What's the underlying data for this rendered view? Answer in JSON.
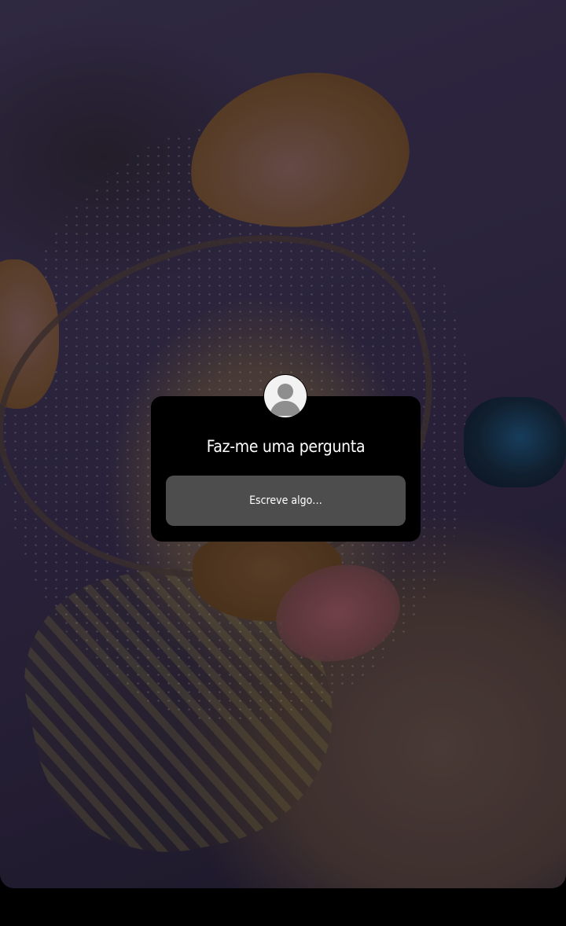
{
  "story": {
    "background_icon": "photo-background"
  },
  "question_sticker": {
    "avatar_icon": "default-avatar-icon",
    "title": "Faz-me uma pergunta",
    "input_placeholder": "Escreve algo…",
    "input_value": ""
  },
  "colors": {
    "sticker_background": "#000000",
    "input_background": "#4d4d4d",
    "text": "#ffffff"
  }
}
